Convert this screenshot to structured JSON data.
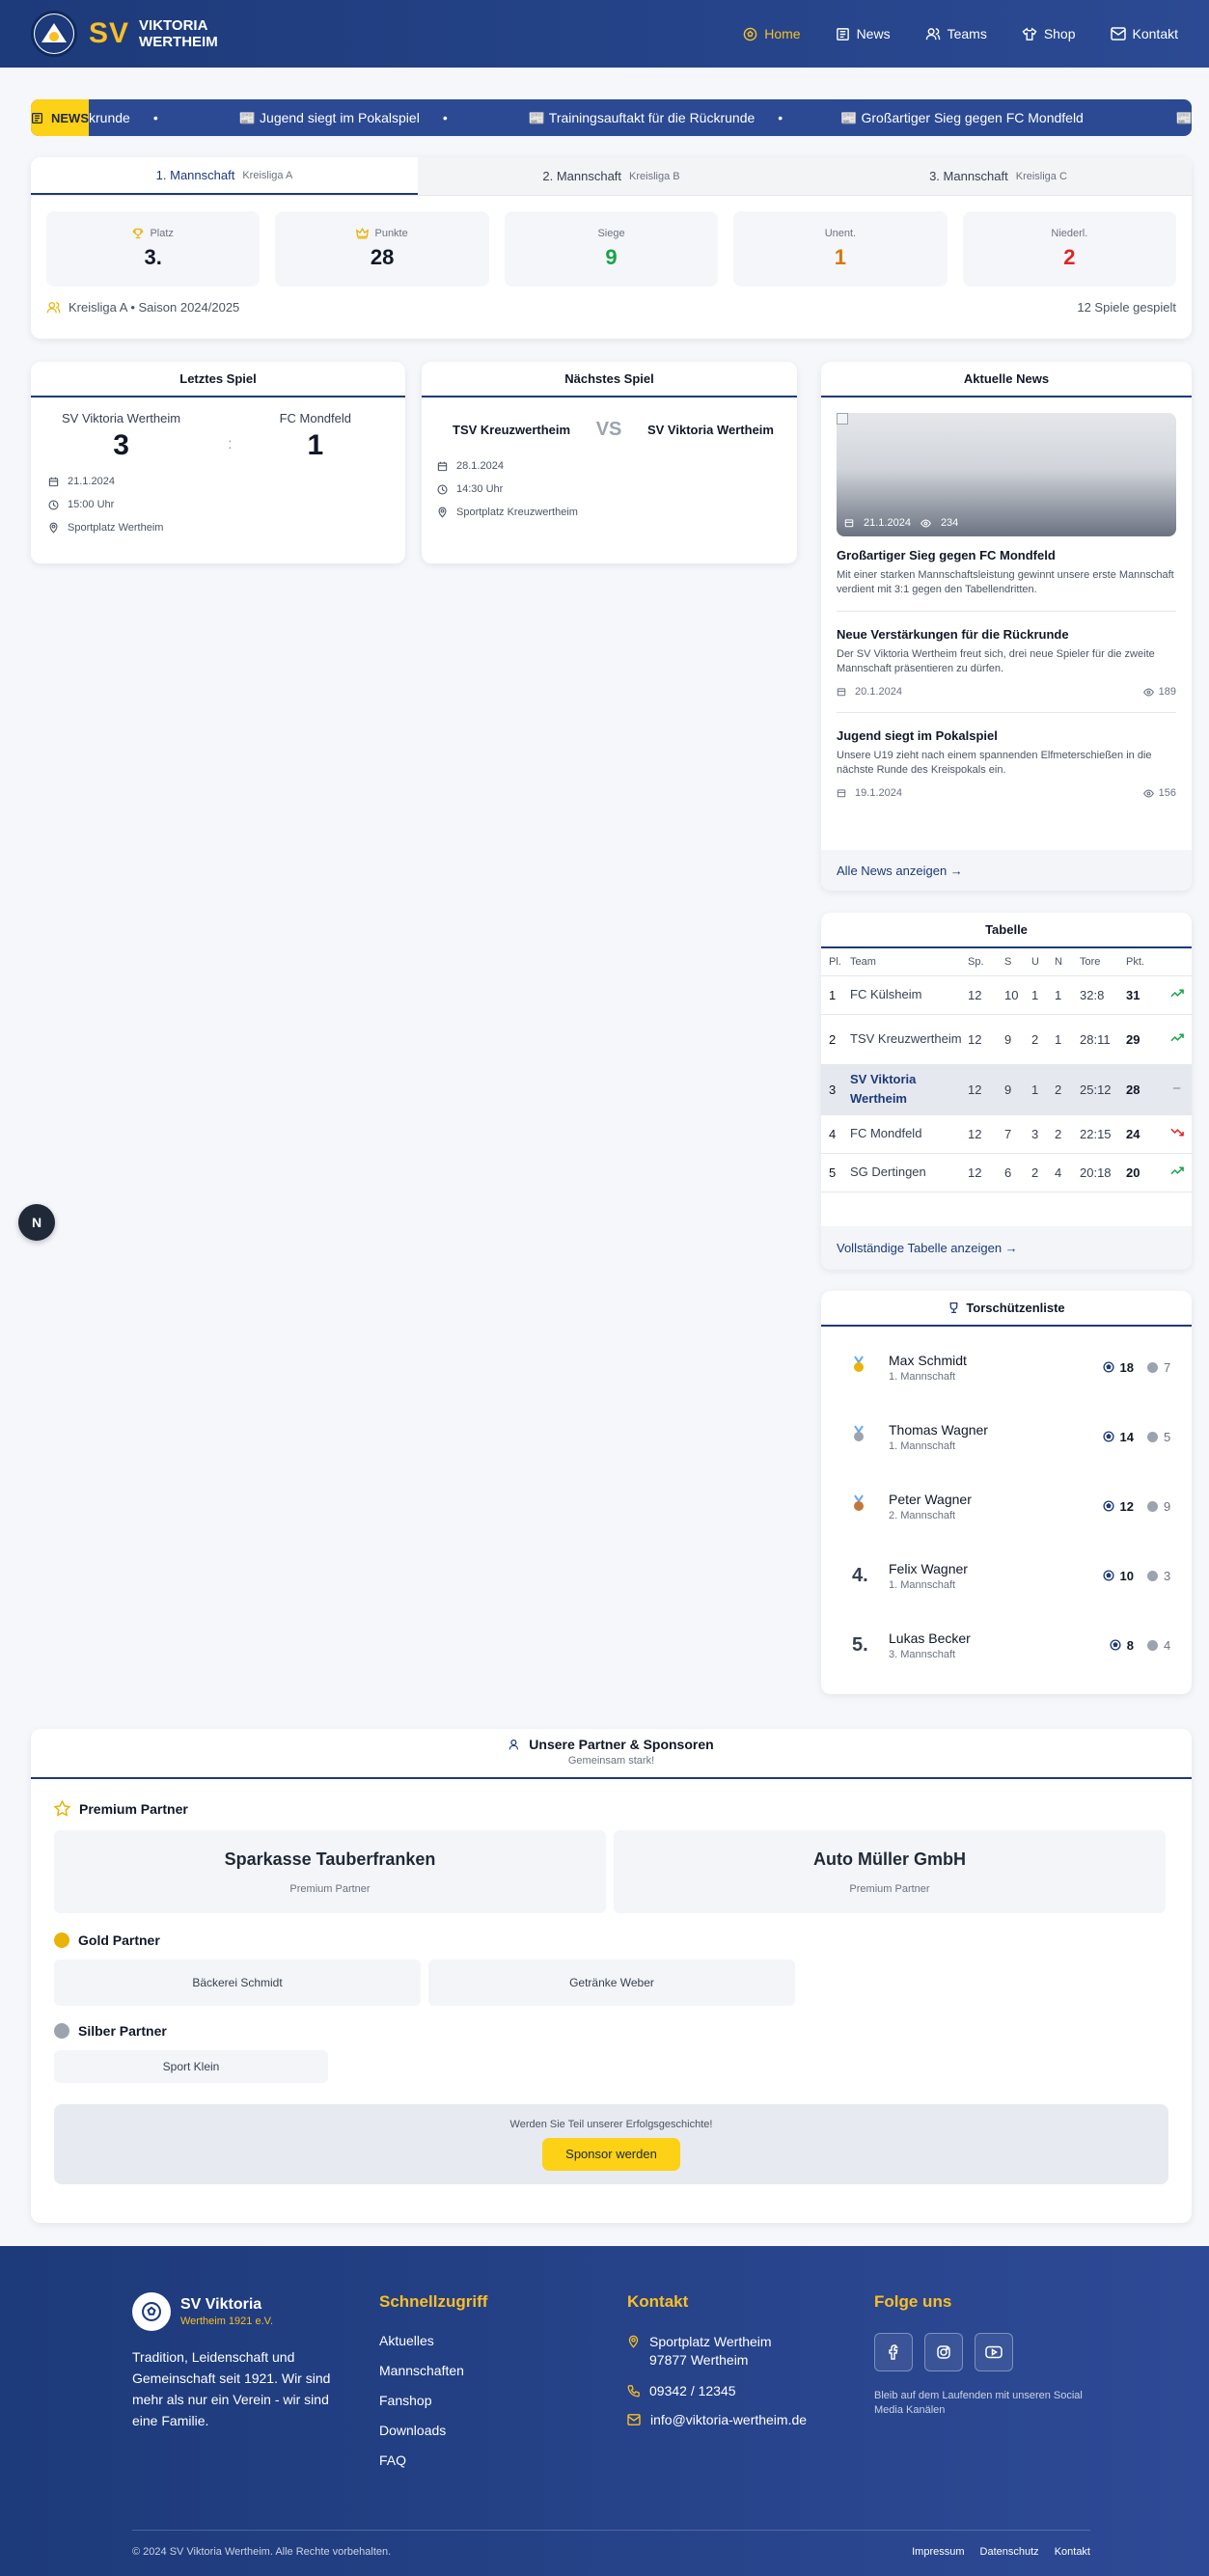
{
  "header": {
    "logo_sv": "SV",
    "logo_line1": "VIKTORIA",
    "logo_line2": "WERTHEIM",
    "nav": [
      {
        "label": "Home",
        "icon": "soccer-ball-icon"
      },
      {
        "label": "News",
        "icon": "newspaper-icon"
      },
      {
        "label": "Teams",
        "icon": "users-icon"
      },
      {
        "label": "Shop",
        "icon": "shirt-icon"
      },
      {
        "label": "Kontakt",
        "icon": "mail-icon"
      }
    ]
  },
  "ticker": {
    "label": "NEWS",
    "items": [
      "krunde",
      "📰 Jugend siegt im Pokalspiel",
      "📰 Trainingsauftakt für die Rückrunde",
      "📰 Großartiger Sieg gegen FC Mondfeld",
      "📰"
    ]
  },
  "teams": {
    "tabs": [
      {
        "name": "1. Mannschaft",
        "league": "Kreisliga A"
      },
      {
        "name": "2. Mannschaft",
        "league": "Kreisliga B"
      },
      {
        "name": "3. Mannschaft",
        "league": "Kreisliga C"
      }
    ],
    "stats": [
      {
        "label": "Platz",
        "value": "3.",
        "color": "#111827"
      },
      {
        "label": "Punkte",
        "value": "28",
        "color": "#111827"
      },
      {
        "label": "Siege",
        "value": "9",
        "color": "#16a34a"
      },
      {
        "label": "Unent.",
        "value": "1",
        "color": "#d97706"
      },
      {
        "label": "Niederl.",
        "value": "2",
        "color": "#dc2626"
      }
    ],
    "season": "Kreisliga A • Saison 2024/2025",
    "played": "12 Spiele gespielt"
  },
  "last_match": {
    "title": "Letztes Spiel",
    "home": "SV Viktoria Wertheim",
    "away": "FC Mondfeld",
    "home_score": "3",
    "away_score": "1",
    "sep": ":",
    "date": "21.1.2024",
    "time": "15:00 Uhr",
    "venue": "Sportplatz Wertheim"
  },
  "next_match": {
    "title": "Nächstes Spiel",
    "home": "TSV Kreuzwertheim",
    "away": "SV Viktoria Wertheim",
    "vs": "VS",
    "date": "28.1.2024",
    "time": "14:30 Uhr",
    "venue": "Sportplatz Kreuzwertheim"
  },
  "news": {
    "title": "Aktuelle News",
    "featured": {
      "date": "21.1.2024",
      "views": "234",
      "title": "Großartiger Sieg gegen FC Mondfeld",
      "text": "Mit einer starken Mannschaftsleistung gewinnt unsere erste Mannschaft verdient mit 3:1 gegen den Tabellendritten."
    },
    "items": [
      {
        "title": "Neue Verstärkungen für die Rückrunde",
        "text": "Der SV Viktoria Wertheim freut sich, drei neue Spieler für die zweite Mannschaft präsentieren zu dürfen.",
        "date": "20.1.2024",
        "views": "189"
      },
      {
        "title": "Jugend siegt im Pokalspiel",
        "text": "Unsere U19 zieht nach einem spannenden Elfmeterschießen in die nächste Runde des Kreispokals ein.",
        "date": "19.1.2024",
        "views": "156"
      }
    ],
    "all_link": "Alle News anzeigen →"
  },
  "table": {
    "title": "Tabelle",
    "headers": [
      "Pl.",
      "Team",
      "Sp.",
      "S",
      "U",
      "N",
      "Tore",
      "Pkt."
    ],
    "rows": [
      {
        "pl": "1",
        "team": "FC Külsheim",
        "sp": "12",
        "s": "10",
        "u": "1",
        "n": "1",
        "tore": "32:8",
        "pkt": "31",
        "trend": "up"
      },
      {
        "pl": "2",
        "team": "TSV Kreuzwertheim",
        "sp": "12",
        "s": "9",
        "u": "2",
        "n": "1",
        "tore": "28:11",
        "pkt": "29",
        "trend": "up"
      },
      {
        "pl": "3",
        "team": "SV Viktoria Wertheim",
        "sp": "12",
        "s": "9",
        "u": "1",
        "n": "2",
        "tore": "25:12",
        "pkt": "28",
        "trend": "same"
      },
      {
        "pl": "4",
        "team": "FC Mondfeld",
        "sp": "12",
        "s": "7",
        "u": "3",
        "n": "2",
        "tore": "22:15",
        "pkt": "24",
        "trend": "down"
      },
      {
        "pl": "5",
        "team": "SG Dertingen",
        "sp": "12",
        "s": "6",
        "u": "2",
        "n": "4",
        "tore": "20:18",
        "pkt": "20",
        "trend": "up"
      }
    ],
    "full_link": "Vollständige Tabelle anzeigen →"
  },
  "scorers": {
    "title": "Torschützenliste",
    "items": [
      {
        "rank": "gold",
        "name": "Max Schmidt",
        "team": "1. Mannschaft",
        "goals": "18",
        "assists": "7"
      },
      {
        "rank": "silver",
        "name": "Thomas Wagner",
        "team": "1. Mannschaft",
        "goals": "14",
        "assists": "5"
      },
      {
        "rank": "bronze",
        "name": "Peter Wagner",
        "team": "2. Mannschaft",
        "goals": "12",
        "assists": "9"
      },
      {
        "rank": "4.",
        "name": "Felix Wagner",
        "team": "1. Mannschaft",
        "goals": "10",
        "assists": "3"
      },
      {
        "rank": "5.",
        "name": "Lukas Becker",
        "team": "3. Mannschaft",
        "goals": "8",
        "assists": "4"
      }
    ]
  },
  "partners": {
    "title": "Unsere Partner & Sponsoren",
    "subtitle": "Gemeinsam stark!",
    "premium_label": "Premium Partner",
    "premium": [
      {
        "name": "Sparkasse Tauberfranken",
        "tag": "Premium Partner"
      },
      {
        "name": "Auto Müller GmbH",
        "tag": "Premium Partner"
      }
    ],
    "gold_label": "Gold Partner",
    "gold": [
      "Bäckerei Schmidt",
      "Getränke Weber"
    ],
    "silver_label": "Silber Partner",
    "silver": [
      "Sport Klein"
    ],
    "cta_text": "Werden Sie Teil unserer Erfolgsgeschichte!",
    "cta_button": "Sponsor werden"
  },
  "footer": {
    "club": "SV Viktoria",
    "club_sub": "Wertheim 1921 e.V.",
    "about": "Tradition, Leidenschaft und Gemeinschaft seit 1921. Wir sind mehr als nur ein Verein - wir sind eine Familie.",
    "quick_title": "Schnellzugriff",
    "quick": [
      "Aktuelles",
      "Mannschaften",
      "Fanshop",
      "Downloads",
      "FAQ"
    ],
    "contact_title": "Kontakt",
    "address1": "Sportplatz Wertheim",
    "address2": "97877 Wertheim",
    "phone": "09342 / 12345",
    "email": "info@viktoria-wertheim.de",
    "follow_title": "Folge uns",
    "follow_text": "Bleib auf dem Laufenden mit unseren Social Media Kanälen",
    "copyright": "© 2024 SV Viktoria Wertheim. Alle Rechte vorbehalten.",
    "legal": [
      "Impressum",
      "Datenschutz",
      "Kontakt"
    ]
  },
  "floating": {
    "label": "N"
  }
}
